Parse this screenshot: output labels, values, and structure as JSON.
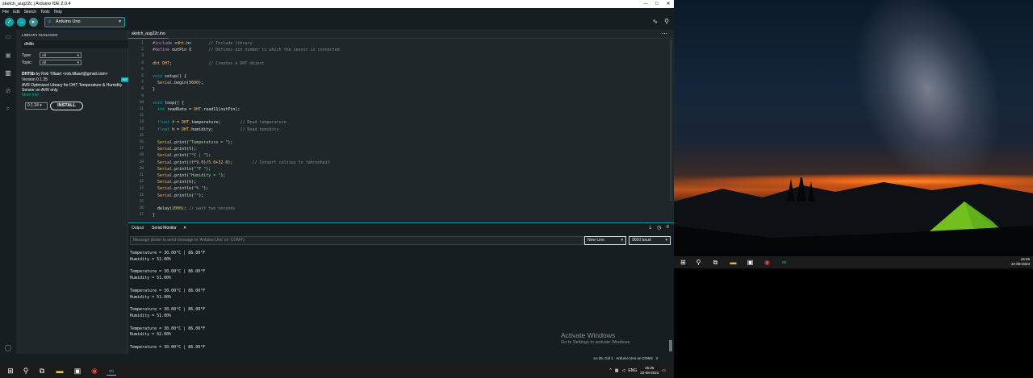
{
  "window": {
    "title": "sketch_aug22c | Arduino IDE 2.0.4",
    "controls": [
      "–",
      "□",
      "✕"
    ]
  },
  "menu": [
    "File",
    "Edit",
    "Sketch",
    "Tools",
    "Help"
  ],
  "toolbar": {
    "board": "Arduino Uno",
    "verify_icon": "check-icon",
    "upload_icon": "arrow-right-icon",
    "debug_icon": "debug-icon",
    "plotter_icon": "plotter-icon",
    "monitor_icon": "search-icon"
  },
  "library_manager": {
    "header": "LIBRARY MANAGER",
    "search_value": "dhtlib",
    "type_label": "Type:",
    "type_value": "All",
    "topic_label": "Topic:",
    "topic_value": "All",
    "lib_name": "DHTlib",
    "lib_author": " by Rob Tillaart <rob.tillaart@gmail.com>",
    "lib_version": "Version 0.1.35",
    "lib_badge": "INSTALLED",
    "lib_desc": "AVR Optimized Library for DHT Temperature & Humidity Sensor on AVR only.",
    "more_info": "More info",
    "version_select": "0.1.34",
    "install_label": "INSTALL"
  },
  "editor": {
    "tab": "sketch_aug22c.ino",
    "lines": [
      {
        "n": "1",
        "t": "#include <dht.h>       // Include library"
      },
      {
        "n": "2",
        "t": "#define outPin 8       // Defines pin number to which the sensor is connected"
      },
      {
        "n": "3",
        "t": ""
      },
      {
        "n": "4",
        "t": "dht DHT;               // Creates a DHT object"
      },
      {
        "n": "5",
        "t": ""
      },
      {
        "n": "6",
        "t": "void setup() {"
      },
      {
        "n": "7",
        "t": "  Serial.begin(9600);"
      },
      {
        "n": "8",
        "t": "}"
      },
      {
        "n": "9",
        "t": ""
      },
      {
        "n": "10",
        "t": "void loop() {"
      },
      {
        "n": "11",
        "t": "  int readData = DHT.read11(outPin);"
      },
      {
        "n": "12",
        "t": ""
      },
      {
        "n": "13",
        "t": "  float t = DHT.temperature;        // Read temperature"
      },
      {
        "n": "14",
        "t": "  float h = DHT.humidity;           // Read humidity"
      },
      {
        "n": "15",
        "t": ""
      },
      {
        "n": "16",
        "t": "  Serial.print(\"Temperature = \");"
      },
      {
        "n": "17",
        "t": "  Serial.print(t);"
      },
      {
        "n": "18",
        "t": "  Serial.print(\"°C | \");"
      },
      {
        "n": "19",
        "t": "  Serial.print((t*9.0)/5.0+32.0);        // Convert celsius to fahrenheit"
      },
      {
        "n": "20",
        "t": "  Serial.println(\"°F \");"
      },
      {
        "n": "21",
        "t": "  Serial.print(\"Humidity = \");"
      },
      {
        "n": "22",
        "t": "  Serial.print(h);"
      },
      {
        "n": "23",
        "t": "  Serial.println(\"% \");"
      },
      {
        "n": "24",
        "t": "  Serial.println(\"\");"
      },
      {
        "n": "25",
        "t": ""
      },
      {
        "n": "26",
        "t": "  delay(2000); // wait two seconds"
      },
      {
        "n": "27",
        "t": "}"
      }
    ]
  },
  "panel": {
    "tab_output": "Output",
    "tab_serial": "Serial Monitor",
    "tab_close": "✕",
    "message_placeholder": "Message (Enter to send message to 'Arduino Uno' on 'COM4')",
    "line_ending": "New Line",
    "baud": "9600 baud",
    "serial_lines": [
      "Temperature = 30.00°C | 86.00°F",
      "Humidity = 51.00%",
      "",
      "Temperature = 30.00°C | 86.00°F",
      "Humidity = 51.00%",
      "",
      "Temperature = 30.00°C | 86.00°F",
      "Humidity = 51.00%",
      "",
      "Temperature = 30.00°C | 86.00°F",
      "Humidity = 51.00%",
      "",
      "Temperature = 30.00°C | 86.00°F",
      "Humidity = 52.00%",
      "",
      "Temperature = 30.00°C | 86.00°F"
    ]
  },
  "watermark": {
    "line1": "Activate Windows",
    "line2": "Go to Settings to activate Windows."
  },
  "statusbar": {
    "text": "Ln 25, Col 1   Arduino Uno on COM4   3"
  },
  "taskbar": {
    "lang": "ENG",
    "time": "16:25",
    "date": "22-08-2023"
  },
  "desktop": {
    "time": "16:25",
    "date": "22-08-2023"
  },
  "colors": {
    "accent": "#0ca1a6",
    "editor_bg": "#1f272a",
    "panel_bg": "#171e21"
  }
}
